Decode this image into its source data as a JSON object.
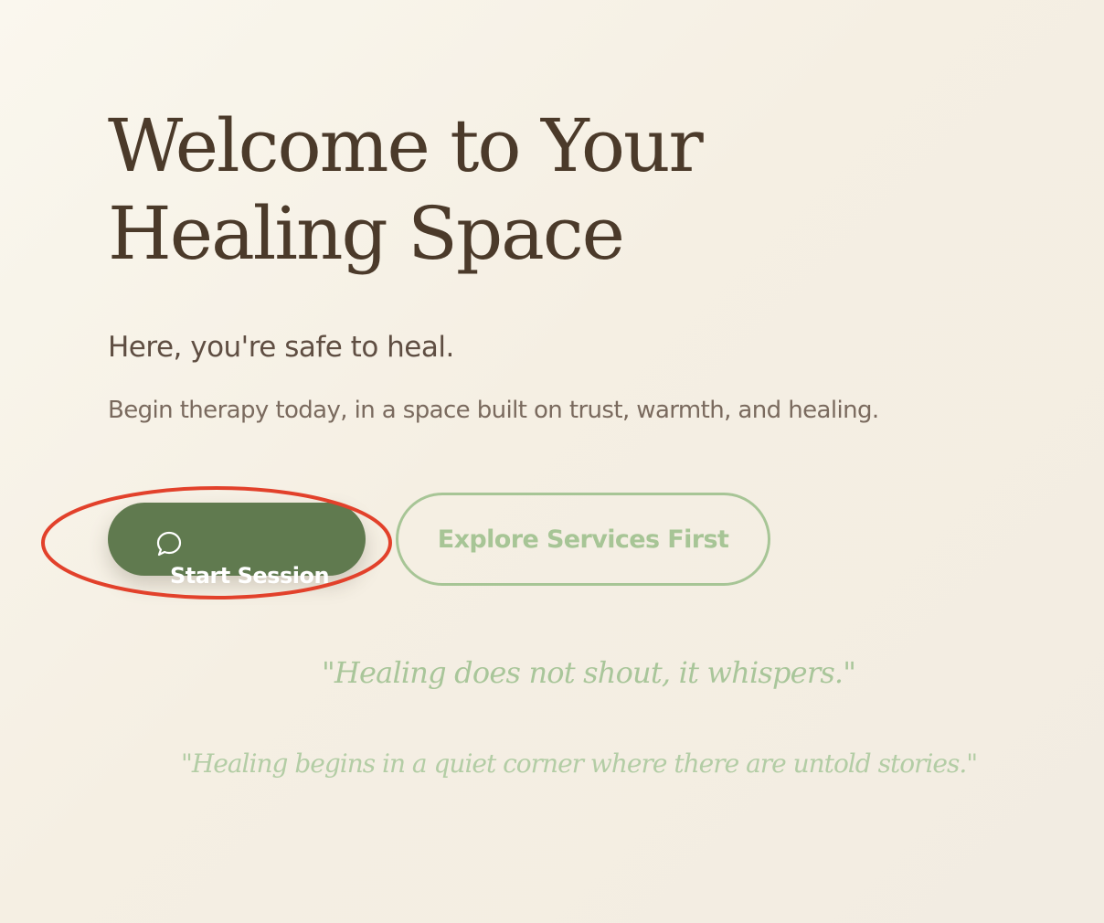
{
  "hero": {
    "title_line1": "Welcome to Your",
    "title_line2": "Healing Space",
    "subtitle": "Here, you're safe to heal.",
    "description": "Begin therapy today, in a space built on trust, warmth, and healing."
  },
  "actions": {
    "primary_label": "Start Session",
    "primary_icon": "chat-bubble-icon",
    "secondary_label": "Explore Services First"
  },
  "quotes": [
    "\"Healing does not shout, it whispers.\"",
    "\"Healing begins in a quiet corner where there are untold stories.\""
  ],
  "colors": {
    "heading": "#4b3a2a",
    "primary_button": "#607a4f",
    "accent_green": "#a7c596",
    "highlight_ring": "#e2412b",
    "background": "#f5efe3"
  }
}
